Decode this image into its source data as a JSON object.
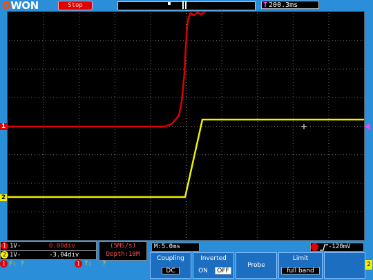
{
  "header": {
    "brand": "OWON",
    "run_state": "Stop",
    "time_offset": "200.3ms"
  },
  "channels": {
    "ch1": {
      "index": "1",
      "scale": "1V-",
      "offset": "0.00div",
      "color": "#e00000"
    },
    "ch2": {
      "index": "2",
      "scale": "1V-",
      "offset": "-3.04div",
      "color": "#f0f000"
    },
    "freq": {
      "label": "F:",
      "value": "?"
    },
    "period": {
      "label": "T:",
      "value": "?"
    }
  },
  "acquisition": {
    "sample_rate": "(5MS/s)",
    "depth": "Depth:10M",
    "timebase": "M:5.0ms"
  },
  "trigger": {
    "level": "-120mV",
    "edge_icon": "rising-edge-icon"
  },
  "menu": {
    "coupling": {
      "label": "Coupling",
      "value": "DC"
    },
    "inverted": {
      "label": "Inverted",
      "on": "ON",
      "off": "OFF"
    },
    "probe": {
      "label": "Probe"
    },
    "limit": {
      "label": "Limit",
      "value": "full band"
    },
    "side_badge": "2"
  }
}
